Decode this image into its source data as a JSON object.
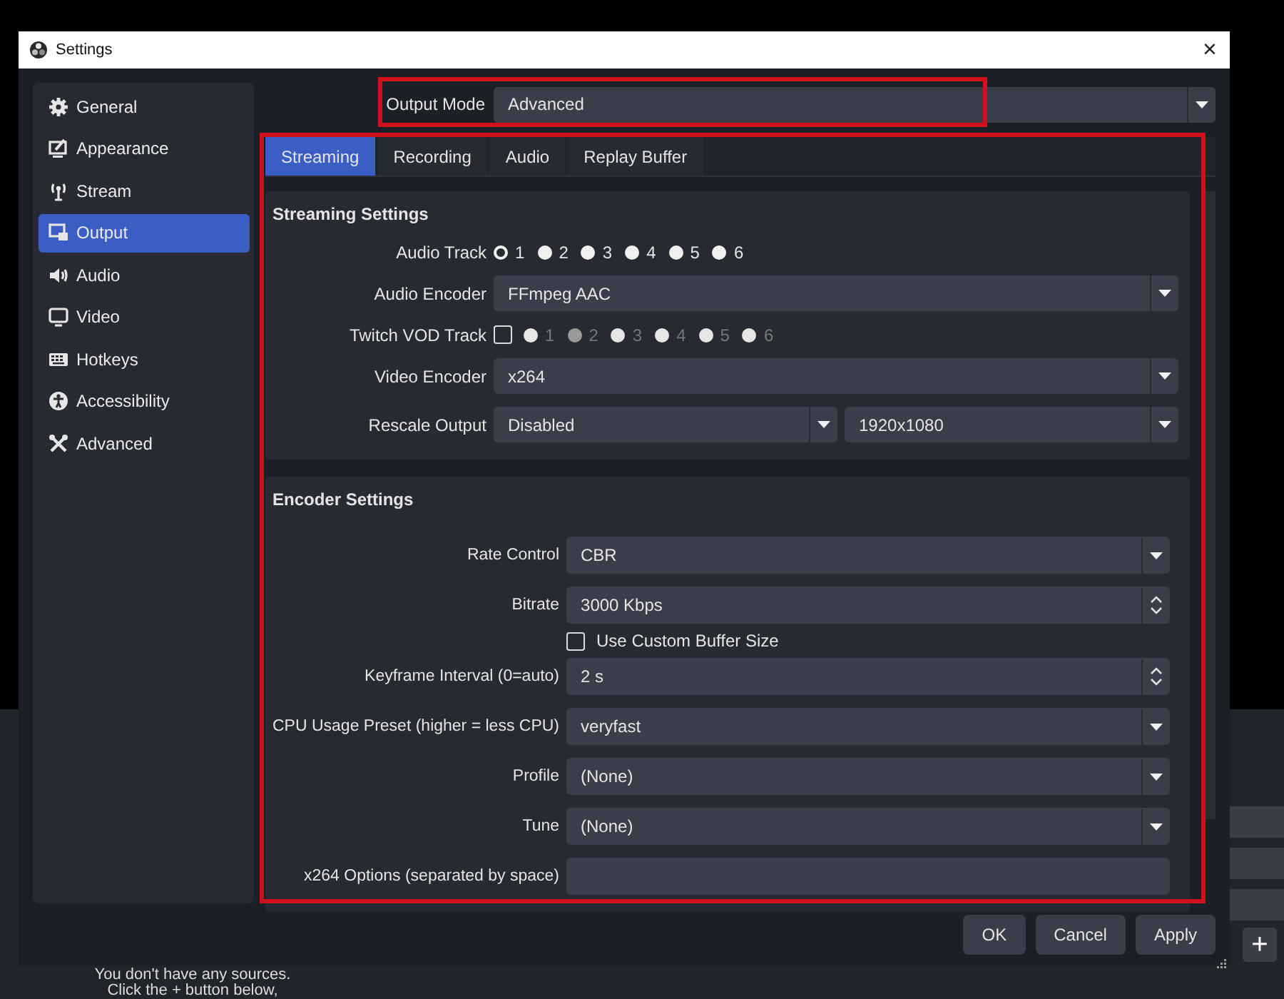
{
  "background_app": {
    "sources_hint": [
      "You don't have any sources.",
      "Click the + button below,"
    ],
    "add_button": "+"
  },
  "window": {
    "title": "Settings",
    "close": "×"
  },
  "sidebar": {
    "items": [
      {
        "label": "General",
        "selected": false
      },
      {
        "label": "Appearance",
        "selected": false
      },
      {
        "label": "Stream",
        "selected": false
      },
      {
        "label": "Output",
        "selected": true
      },
      {
        "label": "Audio",
        "selected": false
      },
      {
        "label": "Video",
        "selected": false
      },
      {
        "label": "Hotkeys",
        "selected": false
      },
      {
        "label": "Accessibility",
        "selected": false
      },
      {
        "label": "Advanced",
        "selected": false
      }
    ]
  },
  "output_mode": {
    "label": "Output Mode",
    "value": "Advanced",
    "highlighted": true
  },
  "tab_panel": {
    "highlighted": true,
    "tabs": [
      {
        "label": "Streaming",
        "selected": true
      },
      {
        "label": "Recording",
        "selected": false
      },
      {
        "label": "Audio",
        "selected": false
      },
      {
        "label": "Replay Buffer",
        "selected": false
      }
    ],
    "groups": [
      {
        "title": "Streaming Settings",
        "rows": [
          {
            "kind": "radios",
            "label": "Audio Track",
            "options": [
              {
                "label": "1",
                "selected": true
              },
              {
                "label": "2",
                "selected": false
              },
              {
                "label": "3",
                "selected": false
              },
              {
                "label": "4",
                "selected": false
              },
              {
                "label": "5",
                "selected": false
              },
              {
                "label": "6",
                "selected": false
              }
            ]
          },
          {
            "kind": "combo",
            "label": "Audio Encoder",
            "value": "FFmpeg AAC"
          },
          {
            "kind": "check-radios",
            "label": "Twitch VOD Track",
            "checked": false,
            "disabled": true,
            "options": [
              {
                "label": "1",
                "selected": false
              },
              {
                "label": "2",
                "selected": true
              },
              {
                "label": "3",
                "selected": false
              },
              {
                "label": "4",
                "selected": false
              },
              {
                "label": "5",
                "selected": false
              },
              {
                "label": "6",
                "selected": false
              }
            ]
          },
          {
            "kind": "combo",
            "label": "Video Encoder",
            "value": "x264"
          },
          {
            "kind": "combo-pair",
            "label": "Rescale Output",
            "values": [
              "Disabled",
              "1920x1080"
            ]
          }
        ]
      },
      {
        "title": "Encoder Settings",
        "rows": [
          {
            "kind": "combo",
            "label": "Rate Control",
            "value": "CBR"
          },
          {
            "kind": "spin",
            "label": "Bitrate",
            "value": "3000 Kbps"
          },
          {
            "kind": "checkbox",
            "text": "Use Custom Buffer Size",
            "checked": false
          },
          {
            "kind": "spin",
            "label": "Keyframe Interval (0=auto)",
            "value": "2 s"
          },
          {
            "kind": "combo",
            "label": "CPU Usage Preset (higher = less CPU)",
            "value": "veryfast"
          },
          {
            "kind": "combo",
            "label": "Profile",
            "value": "(None)"
          },
          {
            "kind": "combo",
            "label": "Tune",
            "value": "(None)"
          },
          {
            "kind": "text",
            "label": "x264 Options (separated by space)"
          }
        ]
      }
    ]
  },
  "buttons": [
    "OK",
    "Cancel",
    "Apply"
  ]
}
